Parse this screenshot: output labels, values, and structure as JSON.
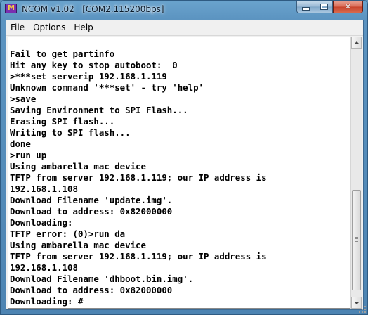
{
  "window": {
    "title": "NCOM v1.02   [COM2,115200bps]",
    "icon_text": "M",
    "buttons": {
      "minimize": "",
      "maximize": "",
      "close": "✕"
    }
  },
  "menu": {
    "items": [
      "File",
      "Options",
      "Help"
    ]
  },
  "terminal": {
    "lines": [
      "Fail to get partinfo",
      "Hit any key to stop autoboot:  0",
      ">***set serverip 192.168.1.119",
      "Unknown command '***set' - try 'help'",
      ">save",
      "Saving Environment to SPI Flash...",
      "Erasing SPI flash...",
      "Writing to SPI flash...",
      "done",
      ">run up",
      "Using ambarella mac device",
      "TFTP from server 192.168.1.119; our IP address is",
      "192.168.1.108",
      "Download Filename 'update.img'.",
      "Download to address: 0x82000000",
      "Downloading:",
      "TFTP error: (0)>run da",
      "Using ambarella mac device",
      "TFTP from server 192.168.1.119; our IP address is",
      "192.168.1.108",
      "Download Filename 'dhboot.bin.img'.",
      "Download to address: 0x82000000",
      "Downloading: #"
    ]
  },
  "colors": {
    "titlebar": "#5b93c0",
    "terminal_bg": "#ffffff",
    "terminal_text": "#000000",
    "close_button": "#c7432b"
  },
  "icons": [
    "app-icon",
    "minimize-icon",
    "maximize-icon",
    "close-icon",
    "scroll-up-icon",
    "scroll-down-icon"
  ]
}
